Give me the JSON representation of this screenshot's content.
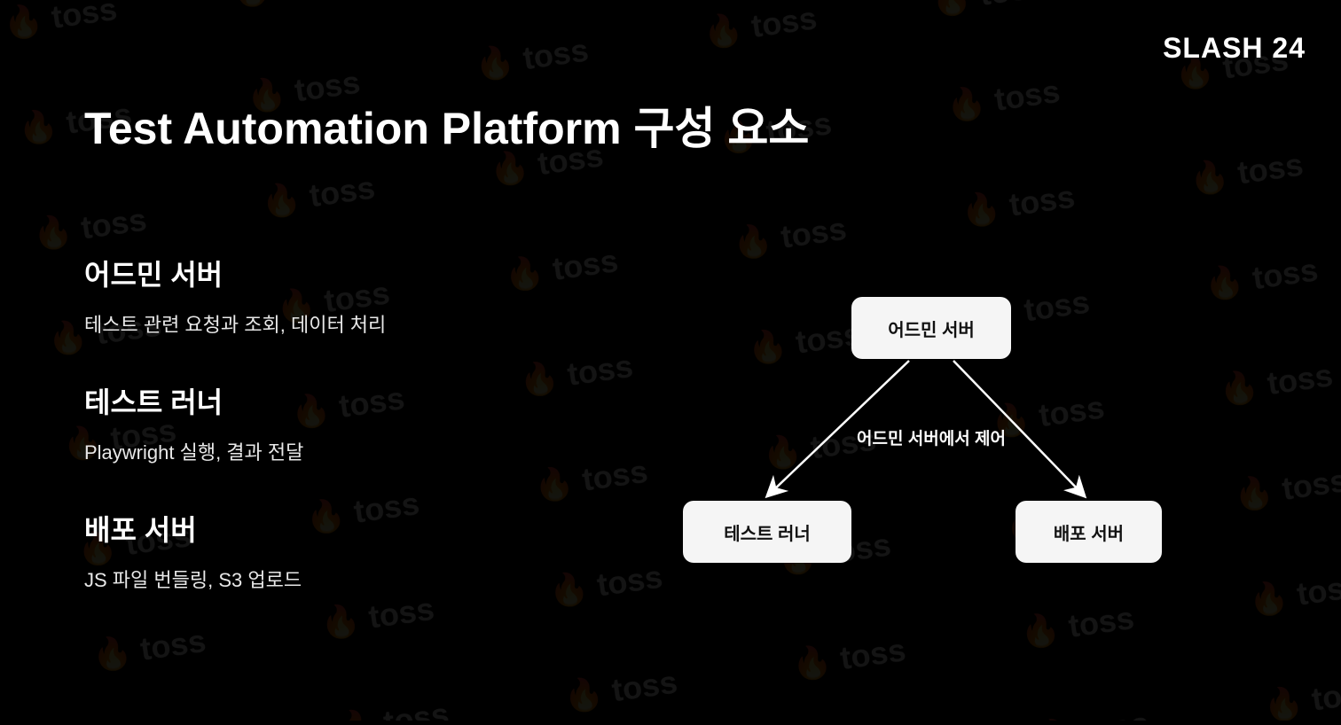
{
  "brand": "SLASH 24",
  "watermark": "toss",
  "title": "Test Automation Platform 구성 요소",
  "sections": [
    {
      "title": "어드민 서버",
      "desc": "테스트 관련 요청과 조회, 데이터 처리"
    },
    {
      "title": "테스트 러너",
      "desc": "Playwright 실행, 결과 전달"
    },
    {
      "title": "배포 서버",
      "desc": "JS 파일 번들링, S3 업로드"
    }
  ],
  "diagram": {
    "top_box": "어드민 서버",
    "left_box": "테스트 러너",
    "right_box": "배포 서버",
    "arrow_label": "어드민 서버에서 제어"
  }
}
